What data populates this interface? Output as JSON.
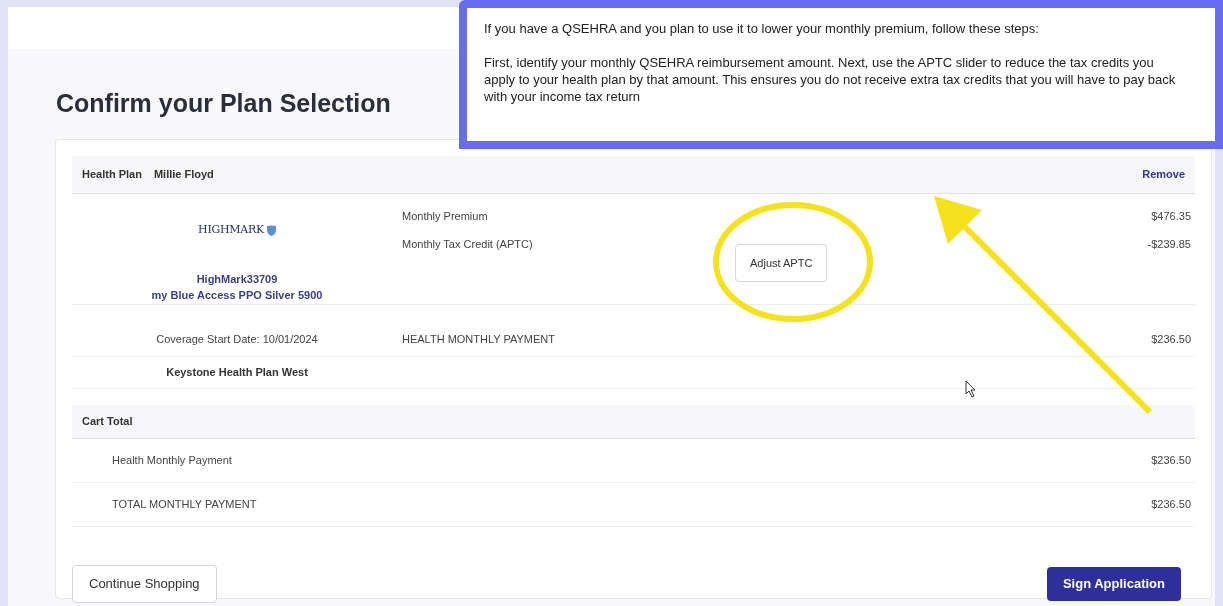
{
  "title": "Confirm your Plan Selection",
  "callout": {
    "paragraphs": [
      "If you have a QSEHRA and you plan to use it to lower your monthly premium, follow these steps:",
      "First, identify your monthly QSEHRA reimbursement amount. Next, use the APTC slider to reduce the tax credits you apply to your health plan by that amount. This ensures you do not receive extra tax credits that you will have to pay back with your income tax return"
    ]
  },
  "plan": {
    "label": "Health Plan",
    "member": "Millie Floyd",
    "remove": "Remove",
    "logo_text": "HIGHMARK",
    "plan_id": "HighMark33709",
    "plan_name": "my Blue Access PPO Silver 5900",
    "coverage": "Coverage Start Date: 10/01/2024",
    "carrier": "Keystone Health Plan West",
    "lines": [
      {
        "label": "Monthly Premium",
        "amount": "$476.35"
      },
      {
        "label": "Monthly Tax Credit (APTC)",
        "amount": "-$239.85"
      }
    ],
    "adjust_button": "Adjust APTC",
    "payment": {
      "label": "HEALTH MONTHLY PAYMENT",
      "amount": "$236.50"
    }
  },
  "cart": {
    "title": "Cart Total",
    "rows": [
      {
        "label": "Health Monthly Payment",
        "amount": "$236.50"
      },
      {
        "label": "TOTAL MONTHLY PAYMENT",
        "amount": "$236.50"
      }
    ]
  },
  "buttons": [
    {
      "label": "Continue Shopping",
      "kind": "secondary"
    },
    {
      "label": "Sign Application",
      "kind": "primary"
    }
  ]
}
